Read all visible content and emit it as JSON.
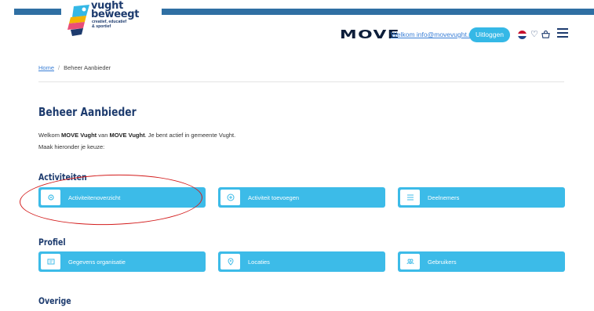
{
  "header": {
    "logo": {
      "title_line1": "vught",
      "title_line2": "beweegt",
      "subtitle_line1": "creatief, educatief",
      "subtitle_line2": "& sportief"
    },
    "brand": "MOVE",
    "welcome_link": "Welkom info@movevught.nl",
    "logout_label": "Uitloggen",
    "icons": [
      "nl-flag-icon",
      "heart-icon",
      "cart-icon",
      "menu-icon"
    ],
    "flag_colors": [
      "#c8102e",
      "#ffffff",
      "#21468b"
    ]
  },
  "breadcrumb": {
    "home": "Home",
    "separator": "/",
    "current": "Beheer Aanbieder"
  },
  "page": {
    "title": "Beheer Aanbieder",
    "intro_prefix": "Welkom ",
    "intro_org": "MOVE Vught",
    "intro_mid": " van ",
    "intro_org2": "MOVE Vught",
    "intro_suffix": ". Je bent actief in gemeente Vught.",
    "intro_line2": "Maak hieronder je keuze:"
  },
  "sections": {
    "activiteiten": {
      "title": "Activiteiten",
      "tiles": [
        {
          "label": "Activiteitenoverzicht",
          "icon": "gear-icon"
        },
        {
          "label": "Activiteit toevoegen",
          "icon": "plus-circle-icon"
        },
        {
          "label": "Deelnemers",
          "icon": "list-icon"
        }
      ]
    },
    "profiel": {
      "title": "Profiel",
      "tiles": [
        {
          "label": "Gegevens organisatie",
          "icon": "id-card-icon"
        },
        {
          "label": "Locaties",
          "icon": "location-pin-icon"
        },
        {
          "label": "Gebruikers",
          "icon": "users-icon"
        }
      ]
    },
    "overige": {
      "title": "Overige"
    }
  },
  "colors": {
    "accent": "#3cbbe8",
    "navy": "#1d3b6e",
    "topbar": "#2f6fa3",
    "annotation": "#d31c1c"
  }
}
